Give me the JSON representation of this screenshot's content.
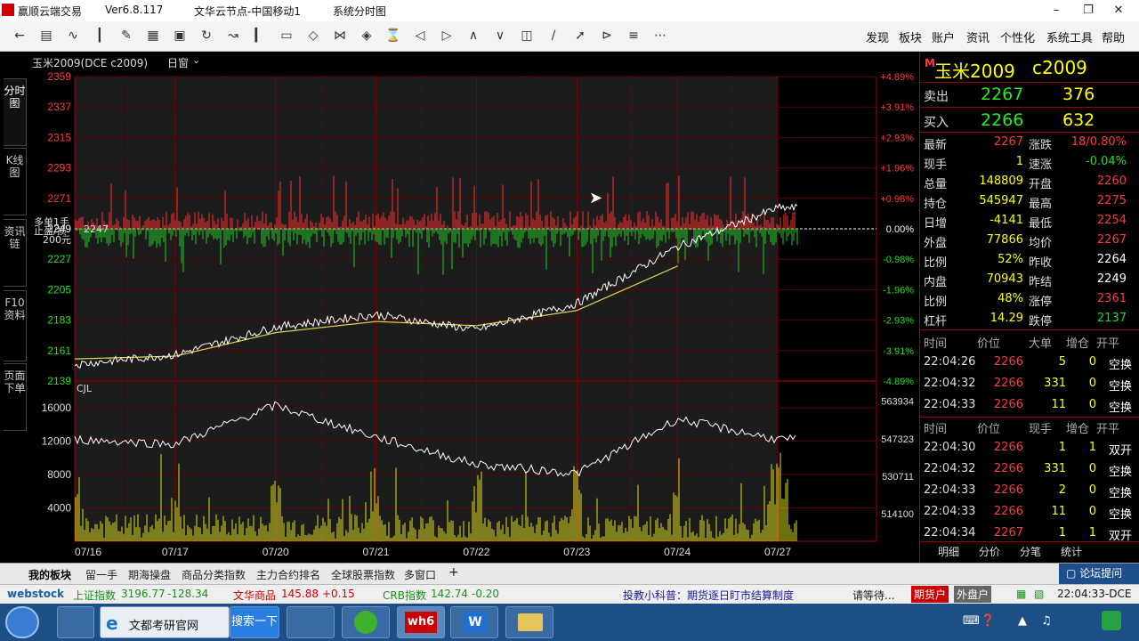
{
  "window": {
    "app_name": "赢顺云端交易",
    "version": "Ver6.8.117",
    "node": "文华云节点-中国移动1",
    "view": "系统分时图",
    "logo_text": "wh6"
  },
  "menu": [
    "发现",
    "板块",
    "账户",
    "资讯",
    "个性化",
    "系统工具",
    "帮助"
  ],
  "side_tabs": [
    "分时图",
    "K线图",
    "资讯链",
    "F10资料",
    "页面下单"
  ],
  "chart_header": {
    "contract": "玉米2009(DCE c2009)",
    "period": "日窗"
  },
  "chart_overlay": {
    "duo_label": "多单1手",
    "stop_label": "止盈/损",
    "price_tag": "2247",
    "amount_tag": "200元",
    "volume_label": "CJL"
  },
  "chart_data": {
    "type": "line",
    "price_axis": [
      2359,
      2337,
      2315,
      2293,
      2271,
      2249,
      2227,
      2205,
      2183,
      2161,
      2139
    ],
    "pct_axis": [
      "+4.89%",
      "+3.91%",
      "+2.93%",
      "+1.96%",
      "+0.98%",
      "0.00%",
      "-0.98%",
      "-1.96%",
      "-2.93%",
      "-3.91%",
      "-4.89%"
    ],
    "prev_settle": 2249,
    "volume_axis": [
      16000,
      12000,
      8000,
      4000
    ],
    "oi_axis": [
      563934,
      547323,
      530711,
      514100
    ],
    "x_labels": [
      "07/16",
      "07/17",
      "07/20",
      "07/21",
      "07/22",
      "07/23",
      "07/24",
      "07/27"
    ],
    "series": [
      {
        "x": [
          "07/16",
          "07/17",
          "07/20",
          "07/21",
          "07/22",
          "07/23",
          "07/24",
          "07/27"
        ],
        "values": [
          2151,
          2158,
          2178,
          2187,
          2176,
          2195,
          2236,
          2264
        ]
      },
      {
        "x": [
          "07/16",
          "07/17",
          "07/20",
          "07/21",
          "07/22",
          "07/23",
          "07/24",
          "07/27"
        ],
        "values": [
          2155,
          2157,
          2174,
          2182,
          2179,
          2190,
          2222,
          2258
        ]
      }
    ],
    "open_interest": [
      547000,
      545000,
      562000,
      548000,
      536000,
      532000,
      556000,
      547000
    ]
  },
  "quote": {
    "badge": "M",
    "name": "玉米2009",
    "code": "c2009",
    "ask_label": "卖出",
    "ask_price": "2267",
    "ask_vol": "376",
    "bid_label": "买入",
    "bid_price": "2266",
    "bid_vol": "632",
    "rows": [
      {
        "l1": "最新",
        "v1": "2267",
        "c1": "#ff3b3b",
        "l2": "涨跌",
        "v2": "18/0.80%",
        "c2": "#ff3b3b"
      },
      {
        "l1": "现手",
        "v1": "1",
        "c1": "#ffff00",
        "l2": "速涨",
        "v2": "-0.04%",
        "c2": "#22dd22"
      },
      {
        "l1": "总量",
        "v1": "148809",
        "c1": "#ffff00",
        "l2": "开盘",
        "v2": "2260",
        "c2": "#ff3b3b"
      },
      {
        "l1": "持仓",
        "v1": "545947",
        "c1": "#ffff00",
        "l2": "最高",
        "v2": "2275",
        "c2": "#ff3b3b"
      },
      {
        "l1": "日增",
        "v1": "-4141",
        "c1": "#ffff00",
        "l2": "最低",
        "v2": "2254",
        "c2": "#ff3b3b"
      },
      {
        "l1": "外盘",
        "v1": "77866",
        "c1": "#ffff00",
        "l2": "均价",
        "v2": "2267",
        "c2": "#ff3b3b"
      },
      {
        "l1": "比例",
        "v1": "52%",
        "c1": "#ffff00",
        "l2": "昨收",
        "v2": "2264",
        "c2": "#ffffff"
      },
      {
        "l1": "内盘",
        "v1": "70943",
        "c1": "#ffff00",
        "l2": "昨结",
        "v2": "2249",
        "c2": "#ffffff"
      },
      {
        "l1": "比例",
        "v1": "48%",
        "c1": "#ffff00",
        "l2": "涨停",
        "v2": "2361",
        "c2": "#ff3b3b"
      },
      {
        "l1": "杠杆",
        "v1": "14.29",
        "c1": "#ffff00",
        "l2": "跌停",
        "v2": "2137",
        "c2": "#22dd22"
      }
    ],
    "bigorder_header": [
      "时间",
      "价位",
      "大单",
      "增仓",
      "开平"
    ],
    "bigorders": [
      [
        "22:04:26",
        "2266",
        "5",
        "0",
        "空换"
      ],
      [
        "22:04:32",
        "2266",
        "331",
        "0",
        "空换"
      ],
      [
        "22:04:33",
        "2266",
        "11",
        "0",
        "空换"
      ]
    ],
    "tick_header": [
      "时间",
      "价位",
      "现手",
      "增仓",
      "开平"
    ],
    "ticks": [
      [
        "22:04:30",
        "2266",
        "1",
        "1",
        "双开"
      ],
      [
        "22:04:32",
        "2266",
        "331",
        "0",
        "空换"
      ],
      [
        "22:04:33",
        "2266",
        "2",
        "0",
        "空换"
      ],
      [
        "22:04:33",
        "2266",
        "11",
        "0",
        "空换"
      ],
      [
        "22:04:34",
        "2267",
        "1",
        "1",
        "双开"
      ]
    ],
    "bottom_tabs": [
      "明细",
      "分价",
      "分笔",
      "统计"
    ]
  },
  "bottom_tabs": [
    "我的板块",
    "留一手",
    "期海操盘",
    "商品分类指数",
    "主力合约排名",
    "全球股票指数",
    "多窗口",
    "+"
  ],
  "forum_link": "论坛提问",
  "status": {
    "brand": "webstock",
    "sh_label": "上证指数",
    "sh_value": "3196.77",
    "sh_change": "-128.34",
    "wh_label": "文华商品",
    "wh_value": "145.88",
    "wh_change": "+0.15",
    "crb_label": "CRB指数",
    "crb_value": "142.74",
    "crb_change": "-0.20",
    "news": "投教小科普：期货逐日盯市结算制度",
    "waiting": "请等待...",
    "btn_qh": "期货户",
    "btn_wp": "外盘户",
    "clock": "22:04:33-DCE"
  },
  "taskbar": {
    "ie_tab": "文都考研官网",
    "search_btn": "搜索一下"
  }
}
